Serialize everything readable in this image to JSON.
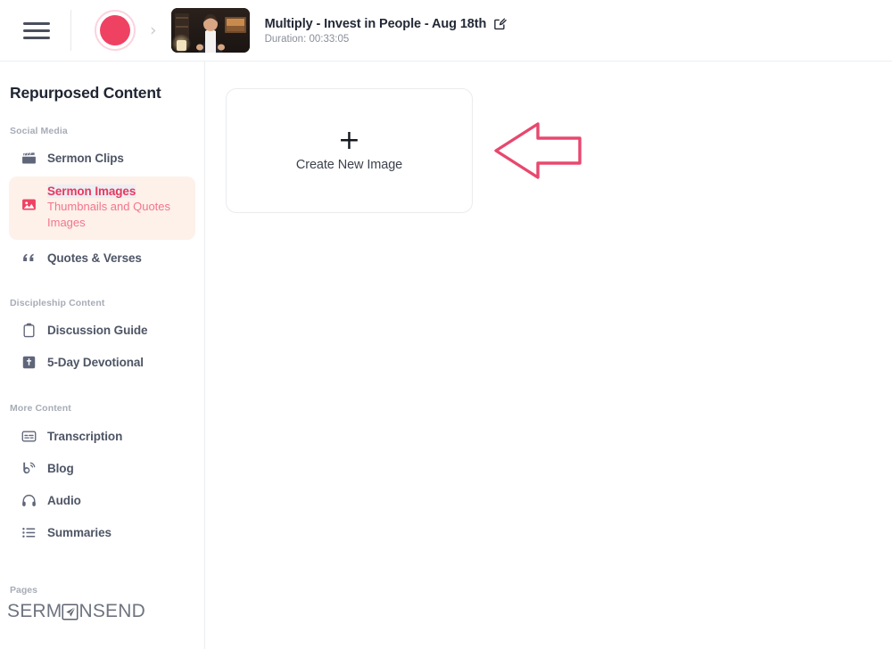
{
  "header": {
    "menu_icon": "hamburger-menu-icon",
    "avatar_icon": "user-avatar",
    "breadcrumb_separator": "›",
    "thumbnail_icon": "video-thumbnail",
    "video_title": "Multiply - Invest in People - Aug 18th",
    "edit_icon": "edit-pencil-icon",
    "duration": "Duration: 00:33:05"
  },
  "sidebar": {
    "title": "Repurposed Content",
    "sections": [
      {
        "label": "Social Media",
        "items": [
          {
            "label": "Sermon Clips",
            "icon": "clapperboard-icon",
            "active": false
          },
          {
            "label": "Sermon Images",
            "sublabel": "Thumbnails and Quotes Images",
            "icon": "image-icon",
            "active": true
          },
          {
            "label": "Quotes & Verses",
            "icon": "quote-icon",
            "active": false
          }
        ]
      },
      {
        "label": "Discipleship Content",
        "items": [
          {
            "label": "Discussion Guide",
            "icon": "clipboard-icon",
            "active": false
          },
          {
            "label": "5-Day Devotional",
            "icon": "bible-book-icon",
            "active": false
          }
        ]
      },
      {
        "label": "More Content",
        "items": [
          {
            "label": "Transcription",
            "icon": "captions-icon",
            "active": false
          },
          {
            "label": "Blog",
            "icon": "blog-rss-icon",
            "active": false
          },
          {
            "label": "Audio",
            "icon": "headphones-icon",
            "active": false
          },
          {
            "label": "Summaries",
            "icon": "list-icon",
            "active": false
          }
        ]
      }
    ],
    "pages_label": "Pages",
    "logo": {
      "text_before": "SERM",
      "mark_icon": "paper-plane-logo-mark",
      "text_after": "NSEND",
      "full_text": "SERMONSEND"
    }
  },
  "main": {
    "create_card": {
      "plus_icon": "plus-icon",
      "label": "Create New Image"
    },
    "annotation": {
      "icon": "left-pointing-arrow-annotation"
    }
  },
  "colors": {
    "accent_pink": "#ef4263",
    "accent_pink_dark": "#e8385c",
    "accent_pink_light": "#f4748c",
    "active_bg": "#fdf1ea",
    "text_dark": "#232936",
    "text_muted": "#8a8f99",
    "label_muted": "#a7acb6",
    "border": "#eceef0",
    "card_border": "#eaebed",
    "background": "#ffffff"
  }
}
